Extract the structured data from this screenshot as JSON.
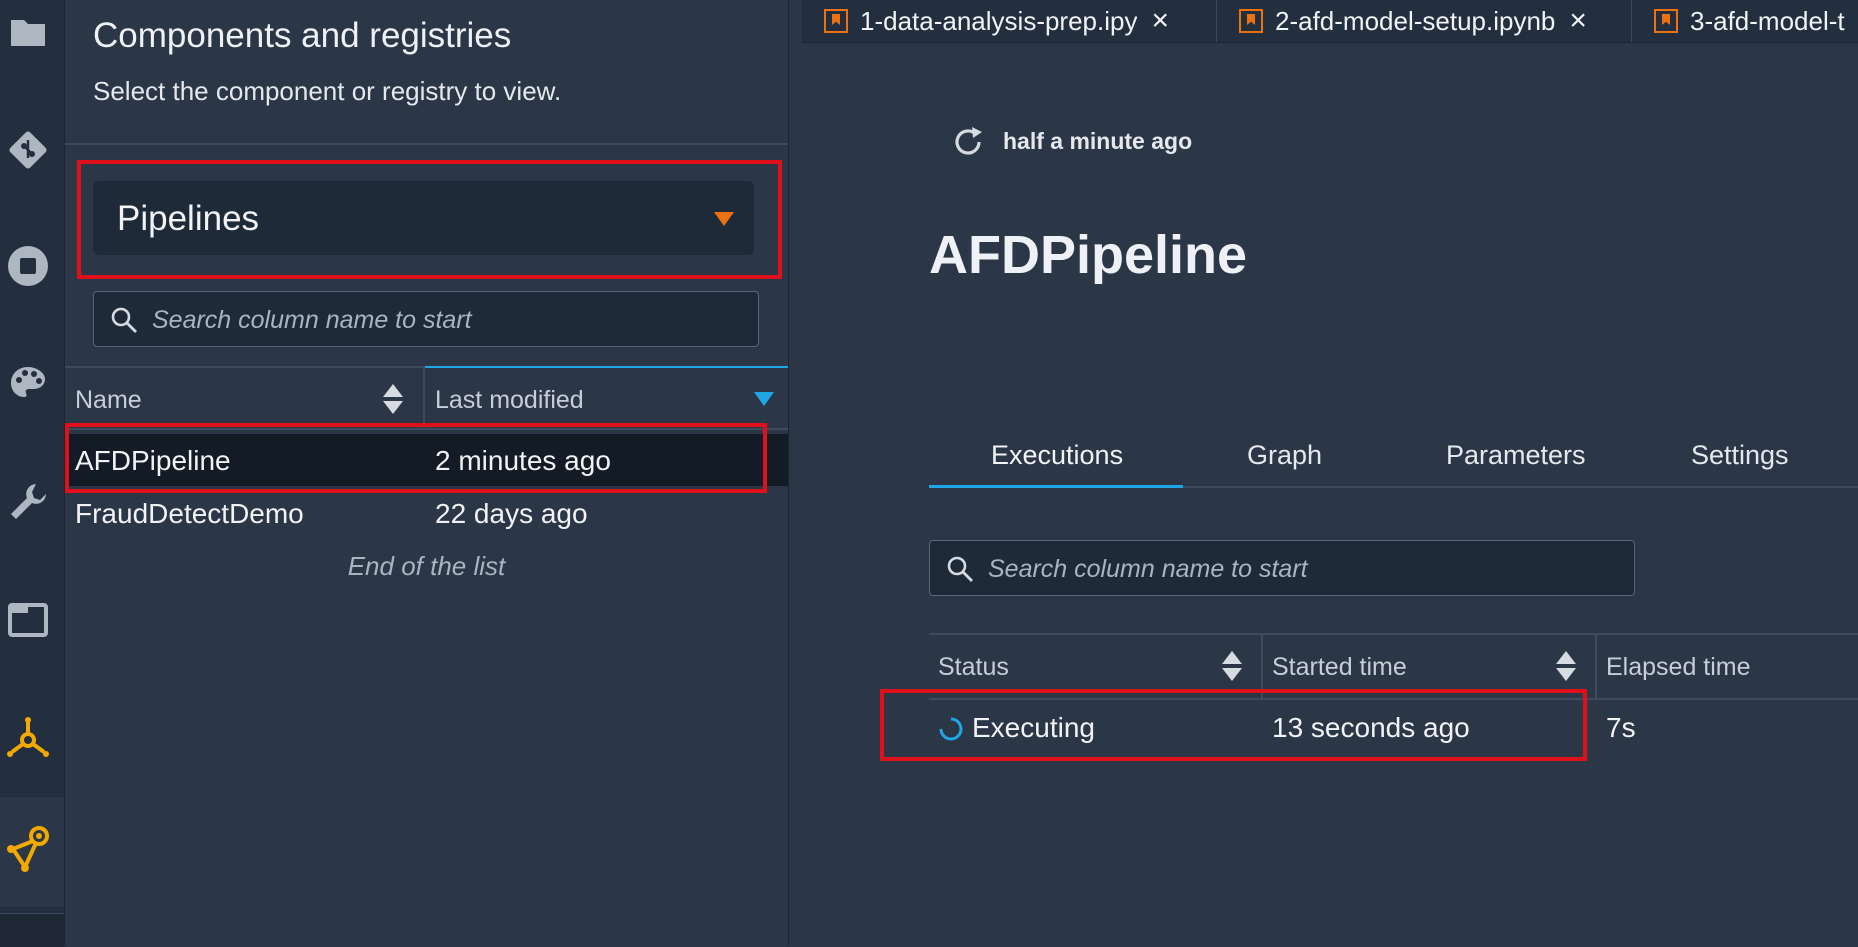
{
  "activity_bar": {
    "icons": [
      "folder-icon",
      "git-icon",
      "stop-circle-icon",
      "palette-icon",
      "wrench-icon",
      "window-icon",
      "components-icon",
      "pipeline-nodes-icon"
    ]
  },
  "side_panel": {
    "title": "Components and registries",
    "subtitle": "Select the component or registry to view.",
    "select_value": "Pipelines",
    "search_placeholder": "Search column name to start",
    "columns": [
      "Name",
      "Last modified"
    ],
    "rows": [
      {
        "name": "AFDPipeline",
        "modified": "2 minutes ago"
      },
      {
        "name": "FraudDetectDemo",
        "modified": "22 days ago"
      }
    ],
    "end_text": "End of the list"
  },
  "main": {
    "tabs": [
      {
        "label": "1-data-analysis-prep.ipy"
      },
      {
        "label": "2-afd-model-setup.ipynb"
      },
      {
        "label": "3-afd-model-t"
      }
    ],
    "refresh_text": "half a minute ago",
    "pipeline_title": "AFDPipeline",
    "section_tabs": [
      "Executions",
      "Graph",
      "Parameters",
      "Settings"
    ],
    "search_placeholder": "Search column name to start",
    "exec_columns": [
      "Status",
      "Started time",
      "Elapsed time"
    ],
    "exec_row": {
      "status": "Executing",
      "started": "13 seconds ago",
      "elapsed": "7s"
    }
  },
  "colors": {
    "accent_orange": "#ec7211",
    "accent_blue": "#1ea7e4",
    "highlight_red": "#e0101a",
    "background": "#2b3647"
  }
}
